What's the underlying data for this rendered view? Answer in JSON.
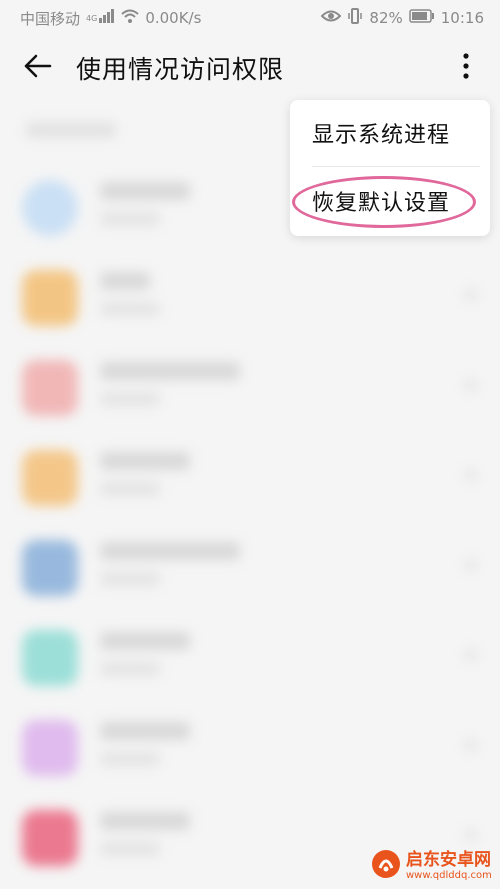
{
  "status_bar": {
    "carrier": "中国移动",
    "network_badge": "4G",
    "speed": "0.00K/s",
    "battery": "82%",
    "time": "10:16"
  },
  "app_bar": {
    "title": "使用情况访问权限"
  },
  "menu": {
    "items": [
      {
        "label": "显示系统进程"
      },
      {
        "label": "恢复默认设置"
      }
    ]
  },
  "list": {
    "icon_colors": [
      "#bcd9f5",
      "#f3b65f",
      "#f0a3a3",
      "#f4b866",
      "#7aa6d6",
      "#7fd8cf",
      "#d9a8ec",
      "#e8506e"
    ]
  },
  "colors": {
    "highlight": "#e0689a",
    "watermark": "#e8541c"
  },
  "watermark": {
    "title": "启东安卓网",
    "url": "www.qdlddq.com"
  }
}
